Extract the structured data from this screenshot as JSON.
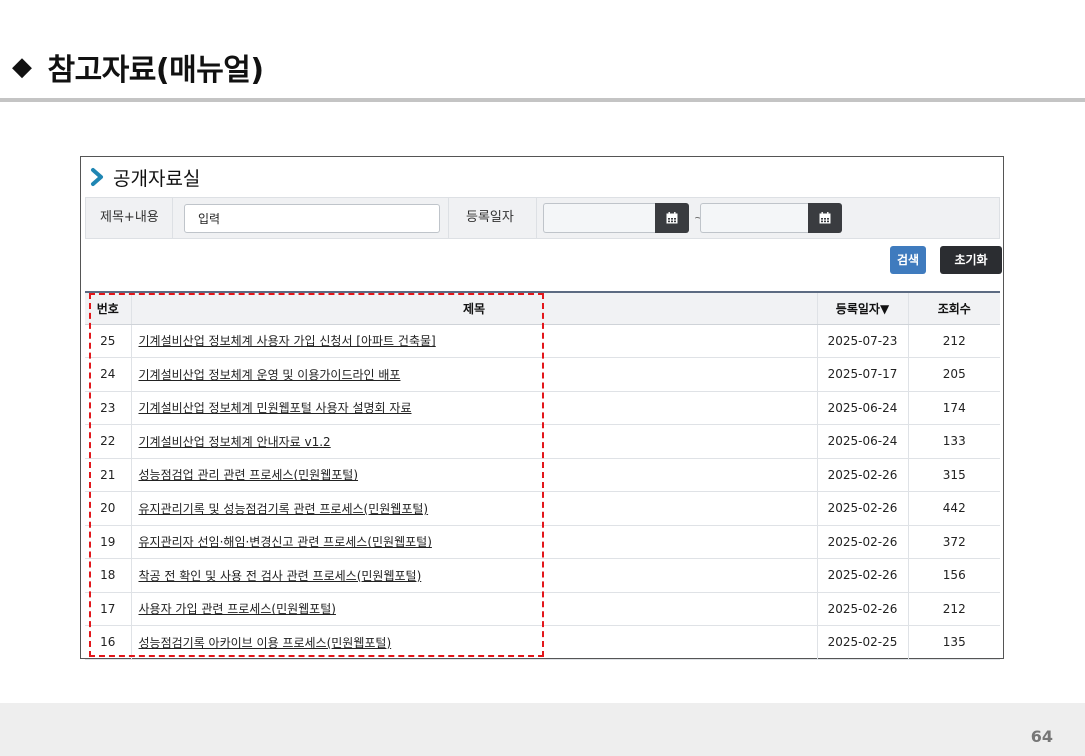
{
  "slide": {
    "marker": "◆",
    "title": "참고자료(매뉴얼)",
    "page_number": "64"
  },
  "panel": {
    "title": "공개자료실",
    "search": {
      "title_label": "제목+내용",
      "title_value": "입력",
      "date_label": "등록일자",
      "date_from": "",
      "date_to": "",
      "range_separator": "~"
    },
    "buttons": {
      "search": "검색",
      "reset": "초기화"
    }
  },
  "table": {
    "headers": {
      "num": "번호",
      "title": "제목",
      "date": "등록일자▼",
      "views": "조회수"
    },
    "rows": [
      {
        "num": "25",
        "title": "기계설비산업 정보체계 사용자 가입 신청서 [아파트 건축물]",
        "date": "2025-07-23",
        "views": "212"
      },
      {
        "num": "24",
        "title": "기계설비산업 정보체계 운영 및 이용가이드라인 배포",
        "date": "2025-07-17",
        "views": "205"
      },
      {
        "num": "23",
        "title": "기계설비산업 정보체계 민원웹포털 사용자 설명회 자료",
        "date": "2025-06-24",
        "views": "174"
      },
      {
        "num": "22",
        "title": "기계설비산업 정보체계 안내자료 v1.2",
        "date": "2025-06-24",
        "views": "133"
      },
      {
        "num": "21",
        "title": "성능점검업 관리 관련 프로세스(민원웹포털)",
        "date": "2025-02-26",
        "views": "315"
      },
      {
        "num": "20",
        "title": "유지관리기록 및 성능점검기록 관련 프로세스(민원웹포털)",
        "date": "2025-02-26",
        "views": "442"
      },
      {
        "num": "19",
        "title": "유지관리자 선임·해임·변경신고 관련 프로세스(민원웹포털)",
        "date": "2025-02-26",
        "views": "372"
      },
      {
        "num": "18",
        "title": "착공 전 확인 및 사용 전 검사 관련 프로세스(민원웹포털)",
        "date": "2025-02-26",
        "views": "156"
      },
      {
        "num": "17",
        "title": "사용자 가입 관련 프로세스(민원웹포털)",
        "date": "2025-02-26",
        "views": "212"
      },
      {
        "num": "16",
        "title": "성능점검기록 아카이브 이용 프로세스(민원웹포털)",
        "date": "2025-02-25",
        "views": "135"
      }
    ]
  },
  "icons": {
    "panel_marker": "chevron-right-icon",
    "date_picker": "calendar-icon"
  },
  "colors": {
    "search_button": "#3f7bbe",
    "reset_button": "#2b2d31",
    "highlight_dash": "#e3171b",
    "chevron": "#2a8fb5"
  }
}
